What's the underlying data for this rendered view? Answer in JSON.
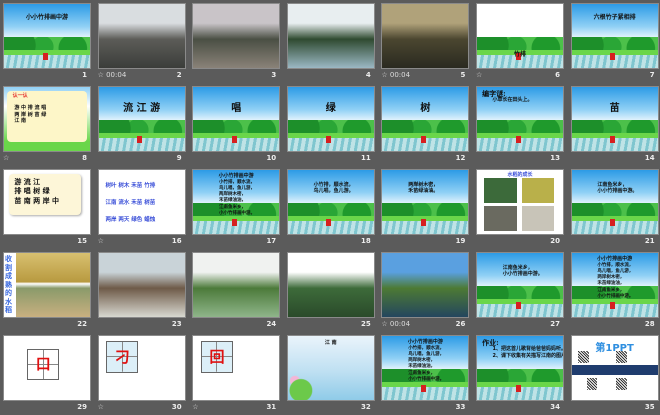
{
  "view": "slide-sorter",
  "colors": {
    "background": "#5b5b5b",
    "title_text": "#111111",
    "blue_text": "#3a4fd8",
    "red_char": "#e01010"
  },
  "slides": [
    {
      "number": "1",
      "type": "scene",
      "title": "小小竹排画中游",
      "title_pos": "top"
    },
    {
      "number": "2",
      "type": "photo",
      "anno": "☆ 00:04",
      "colors": [
        "#d9dde0",
        "#5c5c58",
        "#3b3d3a"
      ]
    },
    {
      "number": "3",
      "type": "photo",
      "colors": [
        "#c9c4c8",
        "#4a4f44",
        "#8a8278"
      ]
    },
    {
      "number": "4",
      "type": "photo",
      "colors": [
        "#e8eef0",
        "#2f4a30",
        "#9bb8c4"
      ]
    },
    {
      "number": "5",
      "type": "photo",
      "anno": "☆ 00:04",
      "colors": [
        "#b0a27a",
        "#4b4630",
        "#2a2a20"
      ]
    },
    {
      "number": "6",
      "type": "scene",
      "anno": "☆",
      "title": "竹排",
      "title_pos": "low"
    },
    {
      "number": "7",
      "type": "scene",
      "title": "六根竹子紧相排",
      "title_pos": "top"
    },
    {
      "number": "8",
      "type": "book",
      "anno": "☆",
      "title": "认一认",
      "lines": [
        "游 中 排 流 唱",
        "两 岸 树 苗 绿",
        "江 南"
      ]
    },
    {
      "number": "9",
      "type": "scene",
      "title": "流 江 游",
      "title_pos": "mid"
    },
    {
      "number": "10",
      "type": "scene",
      "title": "唱",
      "title_pos": "mid"
    },
    {
      "number": "11",
      "type": "scene",
      "title": "绿",
      "title_pos": "mid"
    },
    {
      "number": "12",
      "type": "scene",
      "title": "树",
      "title_pos": "mid"
    },
    {
      "number": "13",
      "type": "scene",
      "title": "编字谜:",
      "lines": [
        "小草长在田头上。"
      ]
    },
    {
      "number": "14",
      "type": "scene",
      "title": "苗",
      "title_pos": "mid"
    },
    {
      "number": "15",
      "type": "card",
      "lines": [
        "游 流 江",
        "排 唱 树 绿",
        "苗 南 两 岸 中"
      ]
    },
    {
      "number": "16",
      "type": "words",
      "anno": "☆",
      "lines": [
        "树叶 树木 禾苗 竹排",
        "江南 流水 禾苗 树苗",
        "两岸 两天 绿色 蜡烛"
      ]
    },
    {
      "number": "17",
      "type": "scene",
      "title": "小小竹排画中游",
      "lines": [
        "小竹排，顺水流，",
        "鸟儿唱，鱼儿游，",
        "两岸树木密，",
        "禾苗绿油油，",
        "江南鱼米乡，",
        "小小竹排画中游。"
      ]
    },
    {
      "number": "18",
      "type": "scene",
      "lines": [
        "小竹排，顺水流，",
        "鸟儿唱，鱼儿游。"
      ]
    },
    {
      "number": "19",
      "type": "scene",
      "lines": [
        "两岸树木密，",
        "禾苗绿油油。"
      ]
    },
    {
      "number": "20",
      "type": "growth",
      "title": "水稻的成长"
    },
    {
      "number": "21",
      "type": "scene",
      "lines": [
        "江南鱼米乡，",
        "小小竹排画中游。"
      ]
    },
    {
      "number": "22",
      "type": "harvest",
      "title": "收割成熟的水稻"
    },
    {
      "number": "23",
      "type": "photo",
      "colors": [
        "#c9d3d8",
        "#6e5a48",
        "#d8d8d0"
      ]
    },
    {
      "number": "24",
      "type": "photo",
      "colors": [
        "#f0f2f0",
        "#4c7a3a",
        "#8fb58a"
      ]
    },
    {
      "number": "25",
      "type": "photo",
      "colors": [
        "#ffffff",
        "#3d6b3a",
        "#2a4a2a"
      ]
    },
    {
      "number": "26",
      "type": "photo",
      "anno": "☆ 00:04",
      "colors": [
        "#5aa0e0",
        "#4d7a34",
        "#24465e"
      ]
    },
    {
      "number": "27",
      "type": "scene",
      "lines": [
        "江南鱼米乡，",
        "小小竹排画中游。"
      ]
    },
    {
      "number": "28",
      "type": "scene",
      "title": "小小竹排画中游",
      "lines": [
        "小竹排，顺水流，",
        "鸟儿唱，鱼儿游，",
        "两岸树木密，",
        "禾苗绿油油，",
        "江南鱼米乡，",
        "小小竹排画中游。"
      ]
    },
    {
      "number": "29",
      "type": "grid",
      "char": "口"
    },
    {
      "number": "30",
      "type": "grid",
      "anno": "☆",
      "char": "刁"
    },
    {
      "number": "31",
      "type": "grid",
      "anno": "☆",
      "char": "回"
    },
    {
      "number": "32",
      "type": "lotus",
      "title": "江 南"
    },
    {
      "number": "33",
      "type": "scene",
      "title": "小小竹排画中游",
      "lines": [
        "小竹排，顺水流，",
        "鸟儿唱，鱼儿游，",
        "两岸树木密，",
        "禾苗绿油油，",
        "江南鱼米乡，",
        "小小竹排画中游。"
      ]
    },
    {
      "number": "34",
      "type": "scene",
      "title": "作业:",
      "lines": [
        "1、把这首儿歌背给爸爸妈妈听。",
        "2、课下收集有关描写江南的图片。"
      ]
    },
    {
      "number": "35",
      "type": "brand",
      "title": "第1PPT"
    }
  ]
}
